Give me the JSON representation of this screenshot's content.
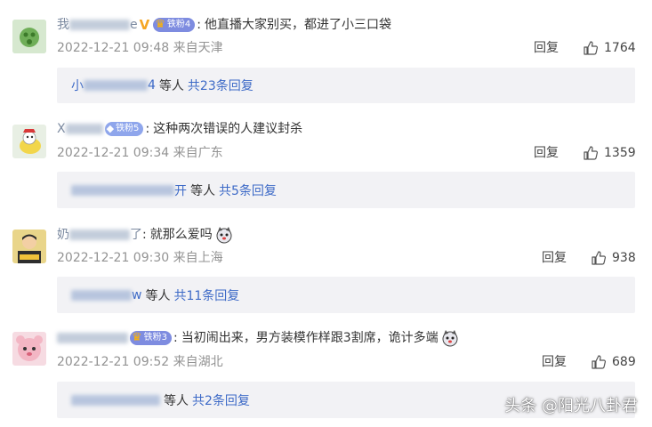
{
  "comments": [
    {
      "name_visible_start": "我",
      "name_visible_end": "e",
      "verified_mark": "V",
      "fan_badge": "铁粉4",
      "text": "他直播大家别买，都进了小三口袋",
      "timestamp": "2022-12-21 09:48",
      "location": "来自天津",
      "reply_label": "回复",
      "likes": "1764",
      "sub_name_start": "小",
      "sub_name_end": "4",
      "sub_others": "等人",
      "sub_link": "共23条回复"
    },
    {
      "name_visible_start": "X",
      "name_visible_end": "",
      "verified_mark": "",
      "fan_badge": "铁粉5",
      "text": "这种两次错误的人建议封杀",
      "timestamp": "2022-12-21 09:34",
      "location": "来自广东",
      "reply_label": "回复",
      "likes": "1359",
      "sub_name_start": "",
      "sub_name_end": "开",
      "sub_others": "等人",
      "sub_link": "共5条回复"
    },
    {
      "name_visible_start": "奶",
      "name_visible_end": "了",
      "verified_mark": "",
      "fan_badge": "",
      "text": "就那么爱吗",
      "timestamp": "2022-12-21 09:30",
      "location": "来自上海",
      "reply_label": "回复",
      "likes": "938",
      "sub_name_start": "",
      "sub_name_end": "w",
      "sub_others": "等人",
      "sub_link": "共11条回复"
    },
    {
      "name_visible_start": "",
      "name_visible_end": "",
      "verified_mark": "",
      "fan_badge": "铁粉3",
      "text": "当初闹出来，男方装模作样跟3割席，诡计多端",
      "timestamp": "2022-12-21 09:52",
      "location": "来自湖北",
      "reply_label": "回复",
      "likes": "689",
      "sub_name_start": "",
      "sub_name_end": "",
      "sub_others": "等人",
      "sub_link": "共2条回复"
    }
  ],
  "watermark": "头条 @阳光八卦君",
  "colors": {
    "link": "#3d6ac7",
    "meta": "#939393",
    "sub_bg": "#f2f2f5",
    "fan_badge": "#7e8ce0",
    "verified": "#f5a623"
  }
}
